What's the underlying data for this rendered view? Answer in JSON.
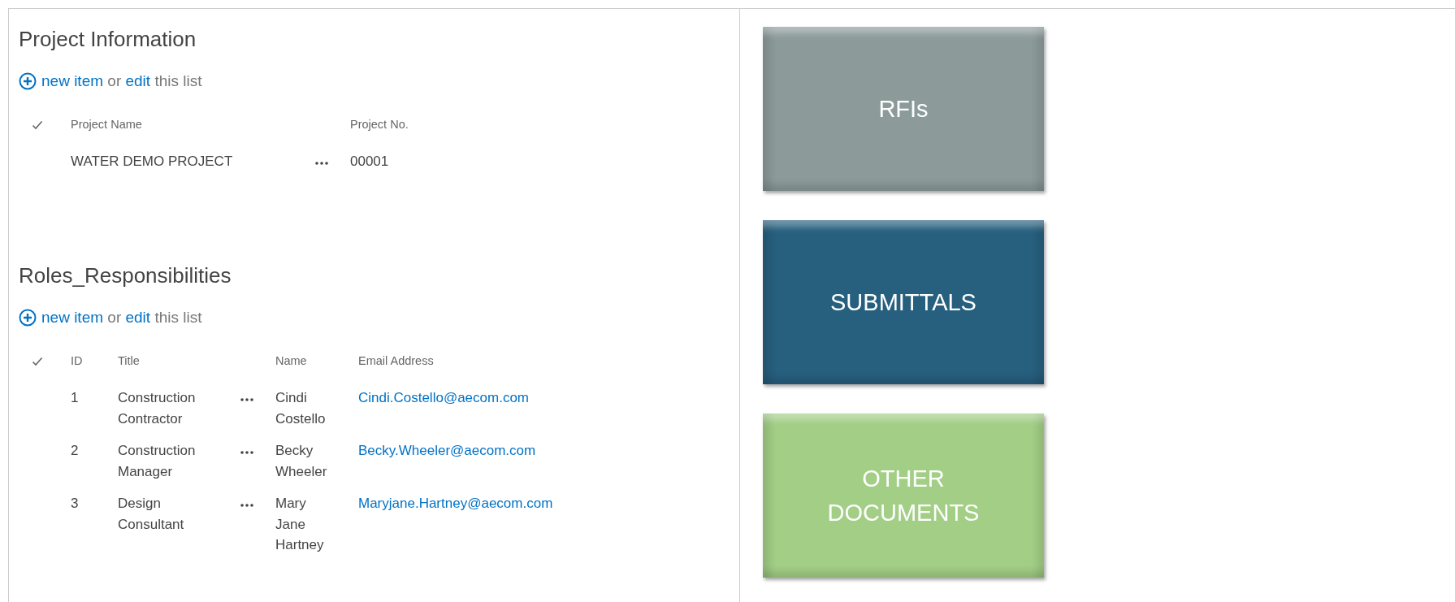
{
  "lists": [
    {
      "title": "Project Information",
      "action": {
        "new_item": "new item",
        "or": "or",
        "edit": "edit",
        "rest": "this list"
      },
      "columns": [
        "Project Name",
        "Project No."
      ],
      "rows": [
        [
          "WATER DEMO PROJECT",
          "00001"
        ]
      ]
    },
    {
      "title": "Roles_Responsibilities",
      "action": {
        "new_item": "new item",
        "or": "or",
        "edit": "edit",
        "rest": "this list"
      },
      "columns": [
        "ID",
        "Title",
        "Name",
        "Email Address"
      ],
      "rows": [
        [
          "1",
          "Construction Contractor",
          "Cindi Costello",
          "Cindi.Costello@aecom.com"
        ],
        [
          "2",
          "Construction Manager",
          "Becky Wheeler",
          "Becky.Wheeler@aecom.com"
        ],
        [
          "3",
          "Design Consultant",
          "Mary Jane Hartney",
          "Maryjane.Hartney@aecom.com"
        ]
      ]
    }
  ],
  "tiles": [
    {
      "label": "RFIs",
      "color": "#8c9a9a"
    },
    {
      "label": "SUBMITTALS",
      "color": "#275f7e"
    },
    {
      "label": "OTHER DOCUMENTS",
      "color": "#a2ce85"
    }
  ]
}
